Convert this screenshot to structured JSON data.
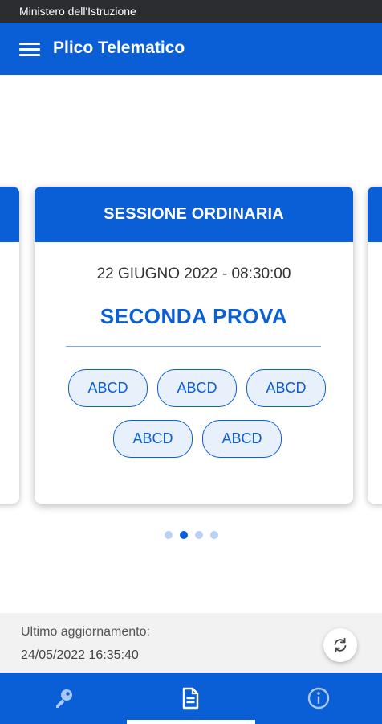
{
  "status_bar": {
    "text": "Ministero dell'Istruzione"
  },
  "app_bar": {
    "title": "Plico Telematico",
    "menu_icon": "hamburger-menu-icon"
  },
  "card": {
    "header": "SESSIONE ORDINARIA",
    "date": "22 GIUGNO 2022 - 08:30:00",
    "prova": "SECONDA PROVA",
    "chips": [
      {
        "label": "ABCD"
      },
      {
        "label": "ABCD"
      },
      {
        "label": "ABCD"
      },
      {
        "label": "ABCD"
      },
      {
        "label": "ABCD"
      }
    ]
  },
  "pager": {
    "count": 4,
    "active_index": 1
  },
  "update_panel": {
    "label": "Ultimo aggiornamento:",
    "value": "24/05/2022 16:35:40",
    "refresh_icon": "refresh-icon"
  },
  "bottom_nav": {
    "items": [
      {
        "icon": "key-icon"
      },
      {
        "icon": "document-icon",
        "selected": true
      },
      {
        "icon": "info-icon"
      }
    ]
  },
  "colors": {
    "primary": "#0b5fd6",
    "chip_bg": "#e8f0fc",
    "status_bar": "#2b2d30",
    "panel_bg": "#f2f2f2"
  }
}
